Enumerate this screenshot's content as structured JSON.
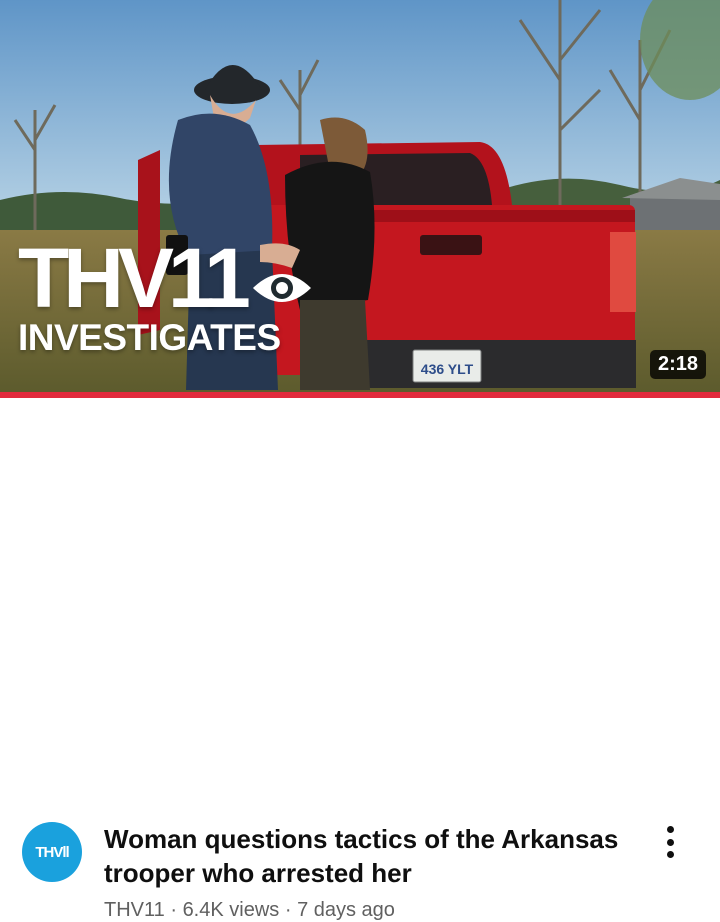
{
  "video": {
    "thumbnail": {
      "brand_callsign": "THV11",
      "brand_subtitle": "INVESTIGATES",
      "license_plate": "436 YLT",
      "duration": "2:18",
      "progress_fraction": 1.0
    },
    "title": "Woman questions tactics of the Arkansas trooper who arrested her",
    "channel": "THV11",
    "views": "6.4K views",
    "age": "7 days ago",
    "separator": "·",
    "avatar_text": "THV11"
  },
  "colors": {
    "progress": "#e22a3d",
    "avatar_bg": "#1aa1dd",
    "truck_red": "#c4171f"
  },
  "icons": {
    "menu": "more-vertical-icon"
  }
}
